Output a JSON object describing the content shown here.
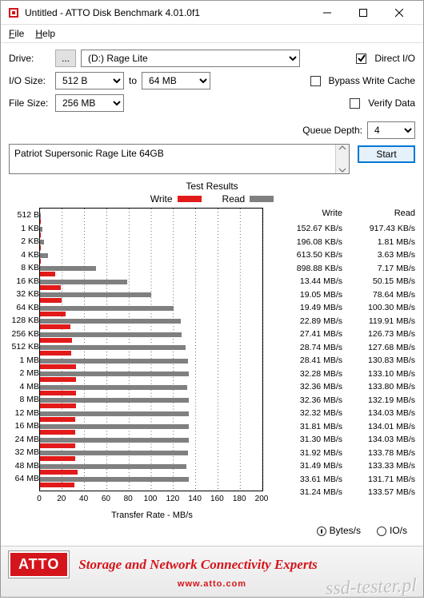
{
  "title": "Untitled - ATTO Disk Benchmark 4.01.0f1",
  "menu": {
    "file": "File",
    "help": "Help"
  },
  "labels": {
    "drive": "Drive:",
    "io_size": "I/O Size:",
    "to": "to",
    "file_size": "File Size:",
    "direct_io": "Direct I/O",
    "bypass": "Bypass Write Cache",
    "verify": "Verify Data",
    "queue_depth": "Queue Depth:",
    "start": "Start",
    "test_results": "Test Results",
    "write": "Write",
    "read": "Read",
    "xlabel": "Transfer Rate - MB/s",
    "bytes_s": "Bytes/s",
    "io_s": "IO/s"
  },
  "drive": "(D:) Rage Lite",
  "io_from": "512 B",
  "io_to": "64 MB",
  "file_size": "256 MB",
  "queue_depth": "4",
  "description": "Patriot Supersonic Rage Lite 64GB",
  "footer": {
    "brand": "ATTO",
    "slogan": "Storage and Network Connectivity Experts",
    "site": "www.atto.com",
    "watermark": "ssd-tester.pl"
  },
  "chart_data": {
    "type": "bar",
    "title": "Test Results",
    "xlabel": "Transfer Rate - MB/s",
    "ylabel": "",
    "xlim": [
      0,
      200
    ],
    "xticks": [
      0,
      20,
      40,
      60,
      80,
      100,
      120,
      140,
      160,
      180,
      200
    ],
    "categories": [
      "512 B",
      "1 KB",
      "2 KB",
      "4 KB",
      "8 KB",
      "16 KB",
      "32 KB",
      "64 KB",
      "128 KB",
      "256 KB",
      "512 KB",
      "1 MB",
      "2 MB",
      "4 MB",
      "8 MB",
      "12 MB",
      "16 MB",
      "24 MB",
      "32 MB",
      "48 MB",
      "64 MB"
    ],
    "series": [
      {
        "name": "Write",
        "color": "#e21a1a",
        "values_label": [
          "152.67 KB/s",
          "196.08 KB/s",
          "613.50 KB/s",
          "898.88 KB/s",
          "13.44 MB/s",
          "19.05 MB/s",
          "19.49 MB/s",
          "22.89 MB/s",
          "27.41 MB/s",
          "28.74 MB/s",
          "28.41 MB/s",
          "32.28 MB/s",
          "32.36 MB/s",
          "32.36 MB/s",
          "32.32 MB/s",
          "31.81 MB/s",
          "31.30 MB/s",
          "31.92 MB/s",
          "31.49 MB/s",
          "33.61 MB/s",
          "31.24 MB/s"
        ],
        "values_mb": [
          0.15,
          0.19,
          0.6,
          0.88,
          13.44,
          19.05,
          19.49,
          22.89,
          27.41,
          28.74,
          28.41,
          32.28,
          32.36,
          32.36,
          32.32,
          31.81,
          31.3,
          31.92,
          31.49,
          33.61,
          31.24
        ]
      },
      {
        "name": "Read",
        "color": "#808080",
        "values_label": [
          "917.43 KB/s",
          "1.81 MB/s",
          "3.63 MB/s",
          "7.17 MB/s",
          "50.15 MB/s",
          "78.64 MB/s",
          "100.30 MB/s",
          "119.91 MB/s",
          "126.73 MB/s",
          "127.68 MB/s",
          "130.83 MB/s",
          "133.10 MB/s",
          "133.80 MB/s",
          "132.19 MB/s",
          "134.03 MB/s",
          "134.01 MB/s",
          "134.03 MB/s",
          "133.78 MB/s",
          "133.33 MB/s",
          "131.71 MB/s",
          "133.57 MB/s"
        ],
        "values_mb": [
          0.9,
          1.81,
          3.63,
          7.17,
          50.15,
          78.64,
          100.3,
          119.91,
          126.73,
          127.68,
          130.83,
          133.1,
          133.8,
          132.19,
          134.03,
          134.01,
          134.03,
          133.78,
          133.33,
          131.71,
          133.57
        ]
      }
    ]
  }
}
